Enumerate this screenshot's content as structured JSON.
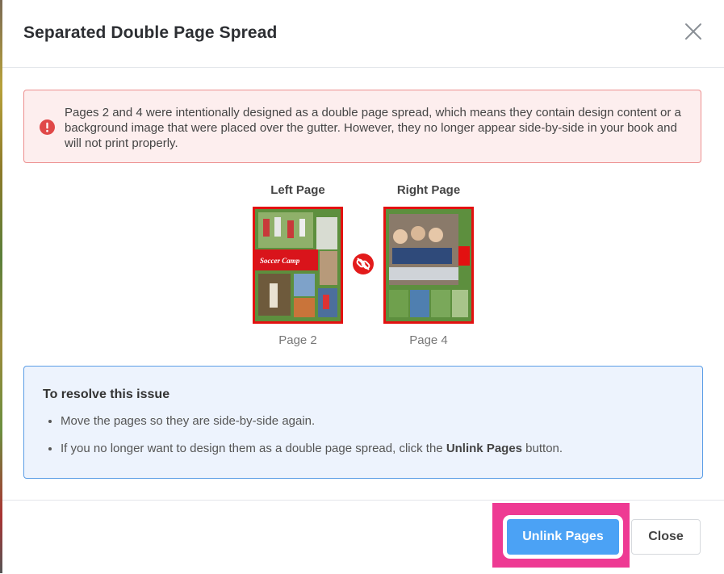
{
  "dialog": {
    "title": "Separated Double Page Spread",
    "close_icon": "close-icon"
  },
  "alert": {
    "icon": "exclamation-circle-icon",
    "text": "Pages 2 and 4 were intentionally designed as a double page spread, which means they contain design content or a background image that were placed over the gutter. However, they no longer appear side-by-side in your book and will not print properly."
  },
  "pages": {
    "left": {
      "heading": "Left Page",
      "caption": "Page 2",
      "banner_text": "Soccer Camp"
    },
    "right": {
      "heading": "Right Page",
      "caption": "Page 4"
    },
    "link_icon": "broken-link-icon"
  },
  "resolve": {
    "title": "To resolve this issue",
    "item1": "Move the pages so they are side-by-side again.",
    "item2_prefix": "If you no longer want to design them as a double page spread, click the ",
    "item2_bold": "Unlink Pages",
    "item2_suffix": " button."
  },
  "footer": {
    "unlink_label": "Unlink Pages",
    "close_label": "Close"
  },
  "colors": {
    "alert_bg": "#fdeeee",
    "alert_border": "#ec8f8f",
    "info_bg": "#edf3fd",
    "info_border": "#5b9de6",
    "primary": "#4ba2f5",
    "highlight": "#ee3a93",
    "thumb_border": "#e31111"
  }
}
